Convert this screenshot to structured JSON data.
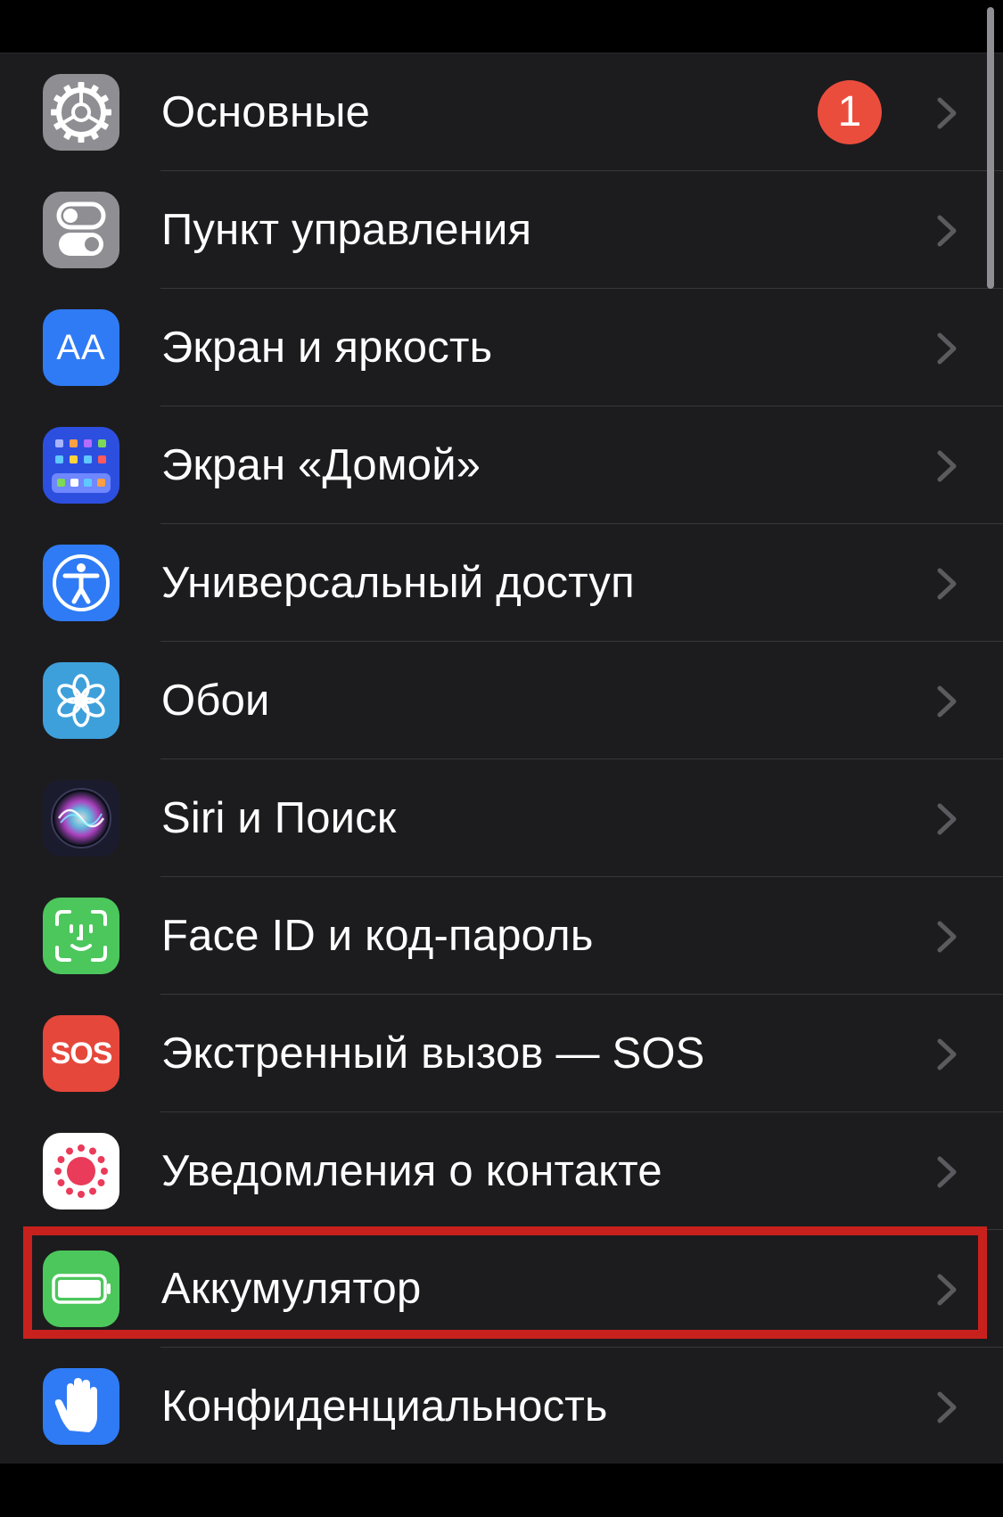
{
  "settings": {
    "items": [
      {
        "key": "general",
        "label": "Основные",
        "icon": "gear-icon",
        "icon_bg": "#8e8e93",
        "badge": "1"
      },
      {
        "key": "control-center",
        "label": "Пункт управления",
        "icon": "toggles-icon",
        "icon_bg": "#8e8e93"
      },
      {
        "key": "display",
        "label": "Экран и яркость",
        "icon": "text-size-icon",
        "icon_bg": "#2f7bf5",
        "icon_text": "AA"
      },
      {
        "key": "home-screen",
        "label": "Экран «Домой»",
        "icon": "app-grid-icon",
        "icon_bg": "#2d4fe0"
      },
      {
        "key": "accessibility",
        "label": "Универсальный доступ",
        "icon": "accessibility-icon",
        "icon_bg": "#2f7bf5"
      },
      {
        "key": "wallpaper",
        "label": "Обои",
        "icon": "flower-icon",
        "icon_bg": "#3ea0da"
      },
      {
        "key": "siri",
        "label": "Siri и Поиск",
        "icon": "siri-icon",
        "icon_bg": "#1b1b2e"
      },
      {
        "key": "face-id",
        "label": "Face ID и код-пароль",
        "icon": "face-id-icon",
        "icon_bg": "#4cc75c"
      },
      {
        "key": "sos",
        "label": "Экстренный вызов — SOS",
        "icon": "sos-icon",
        "icon_bg": "#e5473b",
        "icon_text": "SOS"
      },
      {
        "key": "exposure",
        "label": "Уведомления о контакте",
        "icon": "exposure-icon",
        "icon_bg": "#ffffff"
      },
      {
        "key": "battery",
        "label": "Аккумулятор",
        "icon": "battery-icon",
        "icon_bg": "#4cc75c",
        "highlighted": true
      },
      {
        "key": "privacy",
        "label": "Конфиденциальность",
        "icon": "hand-icon",
        "icon_bg": "#2f7bf5"
      }
    ]
  },
  "colors": {
    "background": "#000000",
    "row_bg": "#1c1c1e",
    "separator": "#38383a",
    "chevron": "#5a5a5f",
    "badge": "#eb4d3d",
    "highlight": "#c8211d"
  }
}
